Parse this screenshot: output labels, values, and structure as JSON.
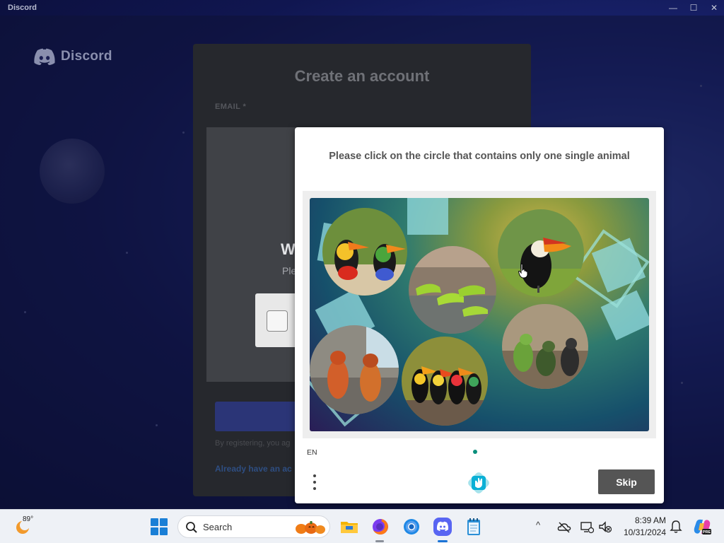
{
  "window": {
    "title": "Discord",
    "controls": {
      "minimize": "—",
      "maximize": "☐",
      "close": "✕"
    }
  },
  "sidebar": {
    "logo_text": "Discord"
  },
  "register": {
    "title": "Create an account",
    "email_label": "EMAIL *",
    "captcha_heading": "W",
    "captcha_sub": "Ple",
    "terms_text": "By registering, you ag",
    "login_link": "Already have an ac"
  },
  "captcha": {
    "prompt": "Please click on the circle that contains only one single animal",
    "language": "EN",
    "skip_label": "Skip",
    "options": [
      {
        "name": "two-toucans"
      },
      {
        "name": "lizards-on-rock"
      },
      {
        "name": "single-toucan"
      },
      {
        "name": "three-lizards-in-room"
      },
      {
        "name": "two-lizards-on-sofa"
      },
      {
        "name": "four-toucans-on-fence"
      }
    ]
  },
  "taskbar": {
    "weather_temp": "89°",
    "search_placeholder": "Search",
    "apps": [
      "file-explorer",
      "firefox",
      "chrome",
      "discord",
      "notepad"
    ],
    "clock_time": "8:39 AM",
    "clock_date": "10/31/2024",
    "tray_chevron": "^"
  },
  "colors": {
    "accent": "#1a73d6",
    "skip_button": "#555555",
    "discord_card": "#26282d",
    "hcaptcha_teal": "#0a8f7c"
  }
}
